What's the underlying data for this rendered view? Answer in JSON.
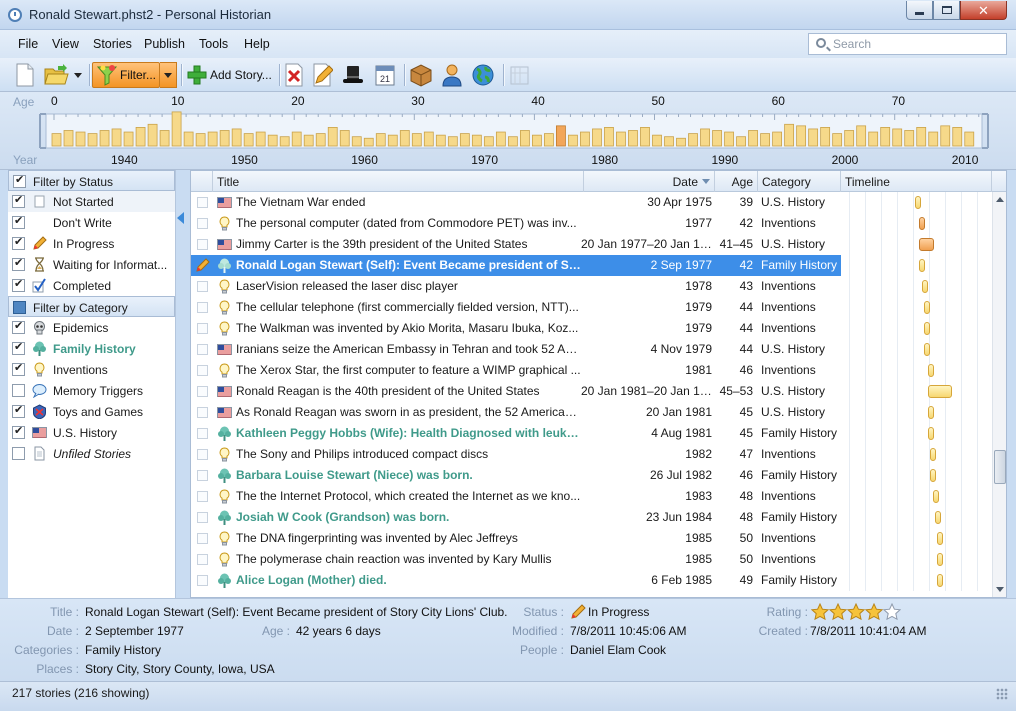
{
  "window": {
    "title": "Ronald Stewart.phst2 - Personal Historian"
  },
  "menu": {
    "items": [
      "File",
      "View",
      "Stories",
      "Publish",
      "Tools",
      "Help"
    ]
  },
  "search": {
    "placeholder": "Search"
  },
  "toolbar": {
    "filter_label": "Filter...",
    "add_story_label": "Add Story..."
  },
  "ruler": {
    "age_label": "Age",
    "year_label": "Year",
    "age_ticks": [
      "0",
      "10",
      "20",
      "30",
      "40",
      "50",
      "60",
      "70"
    ],
    "year_ticks": [
      "1940",
      "1950",
      "1960",
      "1970",
      "1980",
      "1990",
      "2000",
      "2010"
    ]
  },
  "status_filter": {
    "header": "Filter by Status",
    "items": [
      {
        "label": "Not Started",
        "checked": true,
        "icon": "blank-page-icon"
      },
      {
        "label": "Don't Write",
        "checked": true,
        "icon": "blank-icon"
      },
      {
        "label": "In Progress",
        "checked": true,
        "icon": "pencil-icon"
      },
      {
        "label": "Waiting for Informat...",
        "checked": true,
        "icon": "hourglass-icon"
      },
      {
        "label": "Completed",
        "checked": true,
        "icon": "checkmark-icon"
      }
    ]
  },
  "category_filter": {
    "header": "Filter by Category",
    "items": [
      {
        "label": "Epidemics",
        "checked": true,
        "icon": "skull-icon"
      },
      {
        "label": "Family History",
        "checked": true,
        "icon": "family-tree-icon"
      },
      {
        "label": "Inventions",
        "checked": true,
        "icon": "lightbulb-icon"
      },
      {
        "label": "Memory Triggers",
        "checked": false,
        "icon": "speech-bubble-icon"
      },
      {
        "label": "Toys and Games",
        "checked": true,
        "icon": "toy-icon"
      },
      {
        "label": "U.S. History",
        "checked": true,
        "icon": "us-flag-icon"
      },
      {
        "label": "Unfiled Stories",
        "checked": false,
        "icon": "document-icon"
      }
    ]
  },
  "grid": {
    "columns": {
      "title": "Title",
      "date": "Date",
      "age": "Age",
      "category": "Category",
      "timeline": "Timeline"
    },
    "rows": [
      {
        "icon": "us-flag-icon",
        "title": "The Vietnam War ended",
        "date": "30 Apr 1975",
        "age": "39",
        "category": "U.S. History",
        "family": false,
        "bar_start": 1975,
        "bar_end": 1975
      },
      {
        "icon": "lightbulb-icon",
        "title": "The personal computer (dated from Commodore PET) was inv...",
        "date": "1977",
        "age": "42",
        "category": "Inventions",
        "family": false,
        "bar_start": 1977,
        "bar_end": 1977,
        "bar_style": "orange"
      },
      {
        "icon": "us-flag-icon",
        "title": "Jimmy Carter is the 39th president of the United States",
        "date": "20 Jan 1977–20 Jan 1981",
        "age": "41–45",
        "category": "U.S. History",
        "family": false,
        "bar_start": 1977,
        "bar_end": 1981,
        "bar_style": "orange"
      },
      {
        "icon": "family-tree-icon",
        "title": "Ronald Logan Stewart (Self): Event Became president of Sto...",
        "date": "2 Sep 1977",
        "age": "42",
        "category": "Family History",
        "family": true,
        "selected": true,
        "bar_start": 1977,
        "bar_end": 1977
      },
      {
        "icon": "lightbulb-icon",
        "title": "LaserVision released the laser disc player",
        "date": "1978",
        "age": "43",
        "category": "Inventions",
        "family": false,
        "bar_start": 1978,
        "bar_end": 1978
      },
      {
        "icon": "lightbulb-icon",
        "title": "The cellular telephone (first commercially fielded version, NTT)...",
        "date": "1979",
        "age": "44",
        "category": "Inventions",
        "family": false,
        "bar_start": 1979,
        "bar_end": 1979
      },
      {
        "icon": "lightbulb-icon",
        "title": "The Walkman was invented by Akio Morita, Masaru Ibuka, Koz...",
        "date": "1979",
        "age": "44",
        "category": "Inventions",
        "family": false,
        "bar_start": 1979,
        "bar_end": 1979
      },
      {
        "icon": "us-flag-icon",
        "title": "Iranians seize the American Embassy in Tehran and took 52 Am...",
        "date": "4 Nov 1979",
        "age": "44",
        "category": "U.S. History",
        "family": false,
        "bar_start": 1979,
        "bar_end": 1979
      },
      {
        "icon": "lightbulb-icon",
        "title": "The Xerox Star, the first computer to feature a WIMP graphical ...",
        "date": "1981",
        "age": "46",
        "category": "Inventions",
        "family": false,
        "bar_start": 1981,
        "bar_end": 1981
      },
      {
        "icon": "us-flag-icon",
        "title": "Ronald Reagan is the 40th president of the United States",
        "date": "20 Jan 1981–20 Jan 1989",
        "age": "45–53",
        "category": "U.S. History",
        "family": false,
        "bar_start": 1981,
        "bar_end": 1989
      },
      {
        "icon": "us-flag-icon",
        "title": "As Ronald Reagan was sworn in as president, the 52 American h...",
        "date": "20 Jan 1981",
        "age": "45",
        "category": "U.S. History",
        "family": false,
        "bar_start": 1981,
        "bar_end": 1981
      },
      {
        "icon": "family-tree-icon",
        "title": "Kathleen Peggy Hobbs (Wife): Health Diagnosed with leuke...",
        "date": "4 Aug 1981",
        "age": "45",
        "category": "Family History",
        "family": true,
        "bar_start": 1981,
        "bar_end": 1981
      },
      {
        "icon": "lightbulb-icon",
        "title": "The Sony and Philips introduced compact discs",
        "date": "1982",
        "age": "47",
        "category": "Inventions",
        "family": false,
        "bar_start": 1982,
        "bar_end": 1982
      },
      {
        "icon": "family-tree-icon",
        "title": "Barbara Louise Stewart (Niece) was born.",
        "date": "26 Jul 1982",
        "age": "46",
        "category": "Family History",
        "family": true,
        "bar_start": 1982,
        "bar_end": 1982
      },
      {
        "icon": "lightbulb-icon",
        "title": "The the Internet Protocol, which created the Internet as we kno...",
        "date": "1983",
        "age": "48",
        "category": "Inventions",
        "family": false,
        "bar_start": 1983,
        "bar_end": 1983
      },
      {
        "icon": "family-tree-icon",
        "title": "Josiah W Cook (Grandson) was born.",
        "date": "23 Jun 1984",
        "age": "48",
        "category": "Family History",
        "family": true,
        "bar_start": 1984,
        "bar_end": 1984
      },
      {
        "icon": "lightbulb-icon",
        "title": "The DNA fingerprinting was invented by Alec Jeffreys",
        "date": "1985",
        "age": "50",
        "category": "Inventions",
        "family": false,
        "bar_start": 1985,
        "bar_end": 1985
      },
      {
        "icon": "lightbulb-icon",
        "title": "The polymerase chain reaction was invented by Kary Mullis",
        "date": "1985",
        "age": "50",
        "category": "Inventions",
        "family": false,
        "bar_start": 1985,
        "bar_end": 1985
      },
      {
        "icon": "family-tree-icon",
        "title": "Alice Logan (Mother) died.",
        "date": "6 Feb 1985",
        "age": "49",
        "category": "Family History",
        "family": true,
        "bar_start": 1985,
        "bar_end": 1985
      }
    ]
  },
  "details": {
    "title_label": "Title :",
    "title": "Ronald Logan Stewart (Self): Event Became president of Story City Lions' Club.",
    "date_label": "Date :",
    "date": "2 September 1977",
    "age_label": "Age :",
    "age": "42 years 6 days",
    "categories_label": "Categories :",
    "categories": "Family History",
    "places_label": "Places :",
    "places": "Story City, Story County, Iowa, USA",
    "status_label": "Status :",
    "status": "In Progress",
    "modified_label": "Modified :",
    "modified": "7/8/2011 10:45:06 AM",
    "people_label": "People :",
    "people": "Daniel Elam Cook",
    "rating_label": "Rating :",
    "rating": 4,
    "rating_max": 5,
    "created_label": "Created :",
    "created": "7/8/2011 10:41:04 AM"
  },
  "statusbar": {
    "text": "217 stories (216 showing)"
  },
  "colors": {
    "accent": "#3d8ee8",
    "family_text": "#3f9a8a",
    "filter_button": "#f39424"
  }
}
